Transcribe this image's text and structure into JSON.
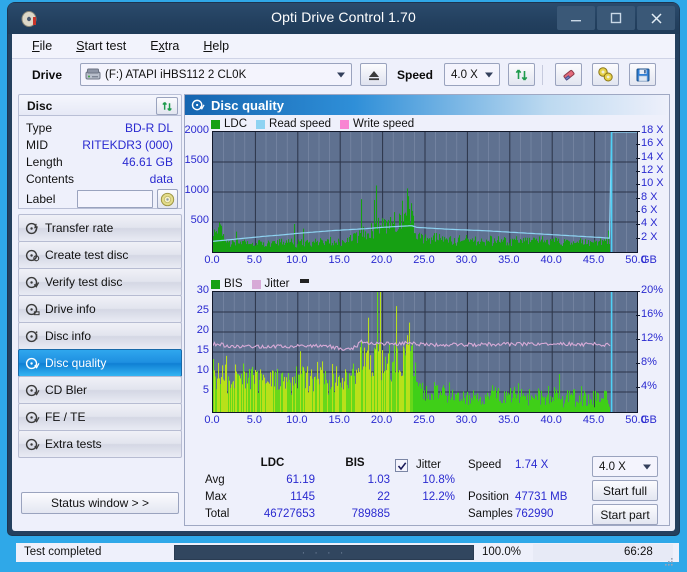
{
  "window": {
    "title": "Opti Drive Control 1.70",
    "icon": "disc-icon",
    "minimize": "minimize-icon",
    "maximize": "maximize-icon",
    "close": "close-icon"
  },
  "menubar": {
    "items": [
      {
        "label": "File",
        "accel": "F"
      },
      {
        "label": "Start test",
        "accel": "S"
      },
      {
        "label": "Extra",
        "accel": "x"
      },
      {
        "label": "Help",
        "accel": "H"
      }
    ]
  },
  "toolbar": {
    "drive_label": "Drive",
    "drive_value": "(F:)  ATAPI iHBS112  2 CL0K",
    "eject_icon": "eject-icon",
    "speed_label": "Speed",
    "speed_value": "4.0 X",
    "refresh_icon": "refresh-icon",
    "erase_icon": "eraser-icon",
    "settings_icon": "gears-icon",
    "save_icon": "floppy-save-icon"
  },
  "disc": {
    "header": "Disc",
    "refresh_icon": "refresh-icon",
    "rows": [
      {
        "key": "Type",
        "value": "BD-R DL"
      },
      {
        "key": "MID",
        "value": "RITEKDR3 (000)"
      },
      {
        "key": "Length",
        "value": "46.61 GB"
      },
      {
        "key": "Contents",
        "value": "data"
      }
    ],
    "label_key": "Label",
    "label_value": "",
    "label_placeholder": "",
    "label_icon": "cd-disc-icon"
  },
  "nav": {
    "items": [
      {
        "label": "Transfer rate",
        "icon": "disc-transfer-icon",
        "selected": false
      },
      {
        "label": "Create test disc",
        "icon": "disc-create-icon",
        "selected": false
      },
      {
        "label": "Verify test disc",
        "icon": "disc-verify-icon",
        "selected": false
      },
      {
        "label": "Drive info",
        "icon": "disc-drive-icon",
        "selected": false
      },
      {
        "label": "Disc info",
        "icon": "disc-info-icon",
        "selected": false
      },
      {
        "label": "Disc quality",
        "icon": "disc-quality-icon",
        "selected": true
      },
      {
        "label": "CD Bler",
        "icon": "disc-bler-icon",
        "selected": false
      },
      {
        "label": "FE / TE",
        "icon": "disc-fete-icon",
        "selected": false
      },
      {
        "label": "Extra tests",
        "icon": "disc-extra-icon",
        "selected": false
      }
    ],
    "status_window": "Status window > >"
  },
  "panel": {
    "header": "Disc quality",
    "header_icon": "disc-quality-icon"
  },
  "chart_data": [
    {
      "type": "area",
      "id": "ldc-chart",
      "title": "",
      "xlabel": "GB",
      "ylabel": "",
      "legend": [
        {
          "label": "LDC",
          "color": "#16a013"
        },
        {
          "label": "Read speed",
          "color": "#8ed3f2"
        },
        {
          "label": "Write speed",
          "color": "#f884d2"
        }
      ],
      "legend_position": "top-left",
      "grid": true,
      "xlim": [
        0,
        50
      ],
      "xticks": [
        "0.0",
        "5.0",
        "10.0",
        "15.0",
        "20.0",
        "25.0",
        "30.0",
        "35.0",
        "40.0",
        "45.0",
        "50.0"
      ],
      "ylim": [
        0,
        2000
      ],
      "yticks": [
        "500",
        "1000",
        "1500",
        "2000"
      ],
      "y2lim": [
        0,
        18
      ],
      "y2ticks": [
        "2 X",
        "4 X",
        "6 X",
        "8 X",
        "10 X",
        "12 X",
        "14 X",
        "16 X",
        "18 X"
      ],
      "x_unit": "GB",
      "series": [
        {
          "name": "LDC",
          "color": "#16a013",
          "x": [
            0.3,
            0.9,
            1.2,
            2,
            3,
            4,
            5,
            6,
            7,
            8,
            9,
            10,
            11,
            12,
            13,
            14,
            15,
            16,
            17,
            17.6,
            18.2,
            18.8,
            19.4,
            20,
            20.6,
            21.2,
            21.8,
            22.2,
            22.6,
            23,
            23.3,
            23.6,
            24,
            24.4,
            25,
            25.6,
            26.2,
            27,
            28,
            29,
            30,
            31,
            32,
            33,
            34,
            35,
            36,
            37,
            38,
            39,
            40,
            41,
            42,
            43,
            44,
            45,
            46,
            46.8
          ],
          "values": [
            330,
            520,
            250,
            190,
            180,
            175,
            185,
            180,
            190,
            185,
            200,
            205,
            195,
            210,
            205,
            215,
            230,
            270,
            320,
            420,
            360,
            480,
            520,
            600,
            560,
            620,
            700,
            660,
            760,
            1145,
            800,
            700,
            430,
            330,
            300,
            260,
            280,
            250,
            230,
            240,
            260,
            230,
            240,
            220,
            230,
            210,
            250,
            230,
            240,
            220,
            230,
            210,
            220,
            200,
            215,
            205,
            200,
            195
          ]
        },
        {
          "name": "Read speed",
          "color": "#8ed3f2",
          "x": [
            0,
            2,
            4,
            6,
            8,
            10,
            12,
            14,
            16,
            18,
            20,
            22,
            23.4,
            24,
            26,
            28,
            30,
            32,
            34,
            36,
            38,
            40,
            42,
            44,
            46,
            46.9,
            47,
            47,
            47
          ],
          "values": [
            1.6,
            1.85,
            2.1,
            2.35,
            2.55,
            2.8,
            3.0,
            3.2,
            3.35,
            3.5,
            3.7,
            3.85,
            3.95,
            3.7,
            3.55,
            3.4,
            3.3,
            3.2,
            3.05,
            2.9,
            2.75,
            2.6,
            2.45,
            2.3,
            2.15,
            2.05,
            4,
            12,
            18
          ]
        },
        {
          "name": "Write speed",
          "color": "#f884d2",
          "x": [],
          "values": []
        }
      ],
      "cursor_x": 47.0,
      "cursor_color": "#4fd0f5"
    },
    {
      "type": "area",
      "id": "bis-jitter-chart",
      "title": "",
      "xlabel": "GB",
      "ylabel": "",
      "legend": [
        {
          "label": "BIS",
          "color": "#16a013"
        },
        {
          "label": "Jitter",
          "color": "#d7aad7"
        }
      ],
      "legend_position": "top-left",
      "grid": true,
      "xlim": [
        0,
        50
      ],
      "xticks": [
        "0.0",
        "5.0",
        "10.0",
        "15.0",
        "20.0",
        "25.0",
        "30.0",
        "35.0",
        "40.0",
        "45.0",
        "50.0"
      ],
      "ylim": [
        0,
        30
      ],
      "yticks": [
        "5",
        "10",
        "15",
        "20",
        "25",
        "30"
      ],
      "y2lim": [
        0,
        20
      ],
      "y2ticks": [
        "4%",
        "8%",
        "12%",
        "16%",
        "20%"
      ],
      "x_unit": "GB",
      "series": [
        {
          "name": "BIS",
          "color": "#3fcf18",
          "x": [
            0.2,
            0.6,
            1,
            1.5,
            2,
            3,
            4,
            5,
            6,
            7,
            8,
            9,
            10,
            11,
            12,
            13,
            14,
            15,
            16,
            17,
            17.4,
            18,
            18.6,
            19.2,
            20,
            20.6,
            21.2,
            21.8,
            22.4,
            23,
            23.4,
            23.8,
            24,
            24.6,
            25,
            26,
            27,
            28,
            29,
            30,
            31,
            32,
            33,
            34,
            35,
            36,
            37,
            38,
            39,
            40,
            41,
            42,
            43,
            44,
            45,
            46,
            46.8
          ],
          "values": [
            15.3,
            13,
            11.5,
            12,
            10.5,
            11,
            10.8,
            10.2,
            11,
            10.6,
            10.4,
            10.8,
            11,
            10.5,
            11.2,
            10.8,
            10.4,
            9.5,
            10,
            18,
            16,
            17,
            16.5,
            19,
            17,
            16.2,
            19.5,
            16,
            17,
            22,
            18,
            15,
            8,
            7,
            6,
            5.5,
            6.5,
            5,
            4.5,
            5,
            4.6,
            4.2,
            4.8,
            4.3,
            4.5,
            5,
            4.2,
            4.6,
            4.3,
            4.5,
            4.1,
            4.4,
            4.2,
            4.3,
            4,
            4.2,
            4
          ]
        },
        {
          "name": "Jitter",
          "color": "#d7aad7",
          "x": [
            0,
            1,
            2,
            3,
            4,
            5,
            6,
            7,
            8,
            9,
            10,
            11,
            12,
            13,
            14,
            15,
            15.5,
            16,
            17,
            17.4,
            18,
            19,
            20,
            21,
            22,
            23,
            24,
            25,
            26,
            27,
            28,
            29,
            30,
            31,
            32,
            33,
            34,
            35,
            36,
            37,
            38,
            39,
            40,
            41,
            42,
            43,
            44,
            45,
            46,
            46.9
          ],
          "values": [
            17,
            16.8,
            16.5,
            16.4,
            16.4,
            16.4,
            16.4,
            16.4,
            16.4,
            16.4,
            16.5,
            16.5,
            16.6,
            16.5,
            16.3,
            15.8,
            15.6,
            15.8,
            16.3,
            18,
            17.2,
            17.1,
            17,
            17.2,
            17,
            17.3,
            17,
            16.9,
            16.8,
            16.8,
            16.9,
            16.8,
            16.9,
            16.8,
            16.9,
            16.9,
            17,
            16.9,
            17,
            17,
            17,
            16.9,
            16.9,
            17,
            17,
            16.9,
            16.9,
            17,
            16.8,
            16.8
          ]
        }
      ],
      "cursor_x": 47.0,
      "cursor_color": "#4fd0f5"
    }
  ],
  "stats": {
    "col_headers": [
      "LDC",
      "BIS"
    ],
    "row_labels": [
      "Avg",
      "Max",
      "Total"
    ],
    "ldc": {
      "avg": "61.19",
      "max": "1145",
      "total": "46727653"
    },
    "bis": {
      "avg": "1.03",
      "max": "22",
      "total": "789885"
    },
    "jitter": {
      "label": "Jitter",
      "checked": true,
      "avg": "10.8%",
      "max": "12.2%"
    },
    "speed_label": "Speed",
    "speed_value": "1.74 X",
    "position_label": "Position",
    "position_value": "47731 MB",
    "samples_label": "Samples",
    "samples_value": "762990",
    "speed_select": "4.0 X",
    "start_full": "Start full",
    "start_part": "Start part"
  },
  "statusbar": {
    "text": "Test completed",
    "progress_pct": "100.0%",
    "progress_value": 100,
    "dots": "· · · ·",
    "time": "66:28"
  }
}
